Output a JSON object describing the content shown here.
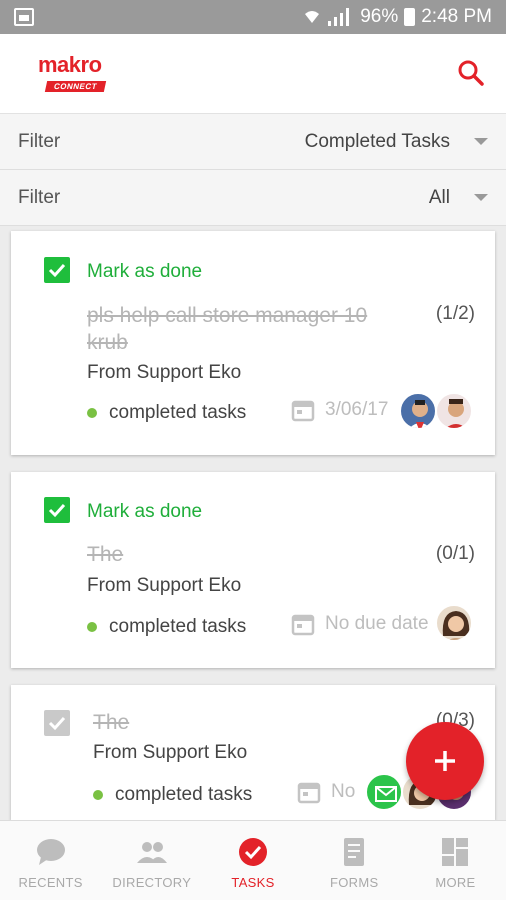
{
  "status_bar": {
    "battery": "96%",
    "time": "2:48 PM"
  },
  "app": {
    "logo_text": "makro",
    "logo_sub": "CONNECT",
    "brand_color": "#e32229"
  },
  "filters": [
    {
      "label": "Filter",
      "value": "Completed Tasks"
    },
    {
      "label": "Filter",
      "value": "All"
    }
  ],
  "tasks": [
    {
      "mark_label": "Mark as done",
      "title": "pls help call store manager 10 krub",
      "count": "(1/2)",
      "from": "From Support Eko",
      "status": "completed tasks",
      "due": "3/06/17"
    },
    {
      "mark_label": "Mark as done",
      "title": "The",
      "count": "(0/1)",
      "from": "From Support Eko",
      "status": "completed tasks",
      "due": "No due date"
    },
    {
      "title": "The",
      "count": "(0/3)",
      "from": "From Support Eko",
      "status": "completed tasks",
      "due": "No"
    }
  ],
  "fab": {
    "icon": "plus-icon"
  },
  "nav": [
    {
      "label": "RECENTS",
      "icon": "chat-bubble-icon"
    },
    {
      "label": "DIRECTORY",
      "icon": "people-icon"
    },
    {
      "label": "TASKS",
      "icon": "check-circle-icon",
      "active": true
    },
    {
      "label": "FORMS",
      "icon": "form-icon"
    },
    {
      "label": "MORE",
      "icon": "grid-icon"
    }
  ],
  "colors": {
    "accent": "#e32229",
    "done_green": "#1fbe3c",
    "status_dot": "#7ac143"
  }
}
